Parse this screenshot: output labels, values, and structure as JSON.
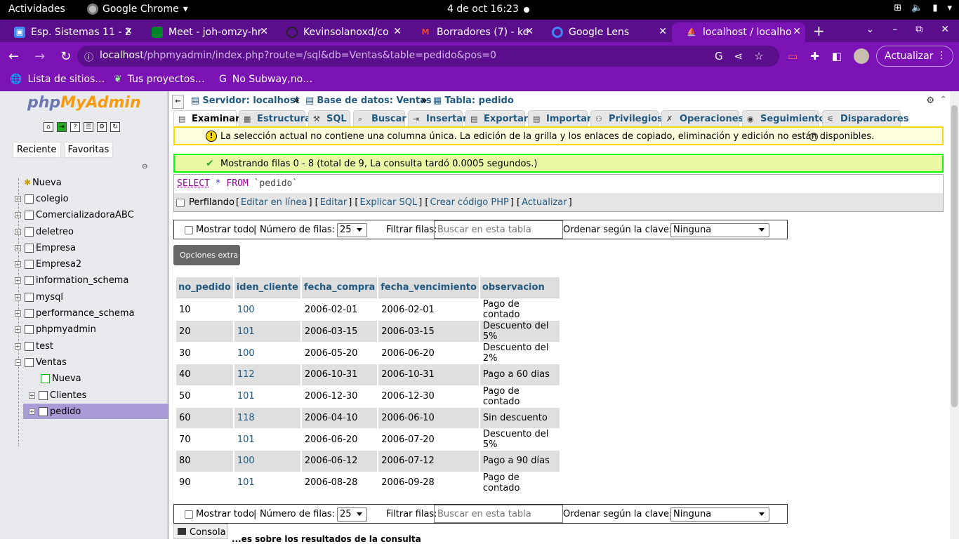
{
  "os": {
    "activities": "Actividades",
    "app_name": "Google Chrome",
    "clock": "4 de oct  16:23"
  },
  "browser": {
    "tabs": [
      {
        "label": "Esp. Sistemas 11 - 2",
        "icon": "classroom-icon"
      },
      {
        "label": "Meet - joh-omzy-hr",
        "icon": "meet-icon"
      },
      {
        "label": "Kevinsolanoxd/co",
        "icon": "github-icon"
      },
      {
        "label": "Borradores (7) - ke",
        "icon": "gmail-icon"
      },
      {
        "label": "Google Lens",
        "icon": "lens-icon"
      },
      {
        "label": "localhost / localho",
        "icon": "phpmyadmin-icon"
      }
    ],
    "url_host": "localhost",
    "url_path": "/phpmyadmin/index.php?route=/sql&db=Ventas&table=pedido&pos=0",
    "update_button": "Actualizar",
    "bookmarks": [
      "Lista de sitios…",
      "Tus proyectos…",
      "No Subway,no…"
    ]
  },
  "sidebar": {
    "logo_php": "php",
    "logo_myadmin": "MyAdmin",
    "tabs": [
      "Reciente",
      "Favoritas"
    ],
    "tree": {
      "new": "Nueva",
      "databases": [
        "colegio",
        "ComercializadoraABC",
        "deletreo",
        "Empresa",
        "Empresa2",
        "information_schema",
        "mysql",
        "performance_schema",
        "phpmyadmin",
        "test",
        "Ventas"
      ],
      "ventas_new": "Nueva",
      "ventas_tables": [
        "Clientes",
        "pedido"
      ]
    }
  },
  "breadcrumb": {
    "server": "Servidor: localhost",
    "database": "Base de datos: Ventas",
    "table": "Tabla: pedido"
  },
  "menu_tabs": [
    "Examinar",
    "Estructura",
    "SQL",
    "Buscar",
    "Insertar",
    "Exportar",
    "Importar",
    "Privilegios",
    "Operaciones",
    "Seguimiento",
    "Disparadores"
  ],
  "notice": "La selección actual no contiene una columna única. La edición de la grilla y los enlaces de copiado, eliminación y edición no están disponibles.",
  "success": "Mostrando filas 0 - 8 (total de 9, La consulta tardó 0.0005 segundos.)",
  "query": {
    "select": "SELECT",
    "star": "*",
    "from": "FROM",
    "table": "`pedido`"
  },
  "query_links": {
    "profiling": "Perfilando",
    "edit_inline": "Editar en línea",
    "edit": "Editar",
    "explain": "Explicar SQL",
    "php_code": "Crear código PHP",
    "refresh": "Actualizar"
  },
  "navigation": {
    "show_all": "Mostrar todo",
    "rows_label": "Número de filas:",
    "rows_value": "25",
    "filter_label": "Filtrar filas:",
    "filter_placeholder": "Buscar en esta tabla",
    "sort_label": "Ordenar según la clave:",
    "sort_value": "Ninguna"
  },
  "extra_options": "Opciones extra",
  "table": {
    "columns": [
      "no_pedido",
      "iden_cliente",
      "fecha_compra",
      "fecha_vencimiento",
      "observacion"
    ],
    "rows": [
      [
        "10",
        "100",
        "2006-02-01",
        "2006-02-01",
        "Pago de contado"
      ],
      [
        "20",
        "101",
        "2006-03-15",
        "2006-03-15",
        "Descuento del 5%"
      ],
      [
        "30",
        "100",
        "2006-05-20",
        "2006-06-20",
        "Descuento del 2%"
      ],
      [
        "40",
        "112",
        "2006-10-31",
        "2006-10-31",
        "Pago a 60 dias"
      ],
      [
        "50",
        "101",
        "2006-12-30",
        "2006-12-30",
        "Pago de contado"
      ],
      [
        "60",
        "118",
        "2006-04-10",
        "2006-06-10",
        "Sin descuento"
      ],
      [
        "70",
        "101",
        "2006-06-20",
        "2006-07-20",
        "Descuento del 5%"
      ],
      [
        "80",
        "100",
        "2006-06-12",
        "2006-07-12",
        "Pago a 90 días"
      ],
      [
        "90",
        "101",
        "2006-08-28",
        "2006-09-28",
        "Pago de contado"
      ]
    ]
  },
  "console": "Consola",
  "cut_text": "...es sobre los resultados de la consulta"
}
